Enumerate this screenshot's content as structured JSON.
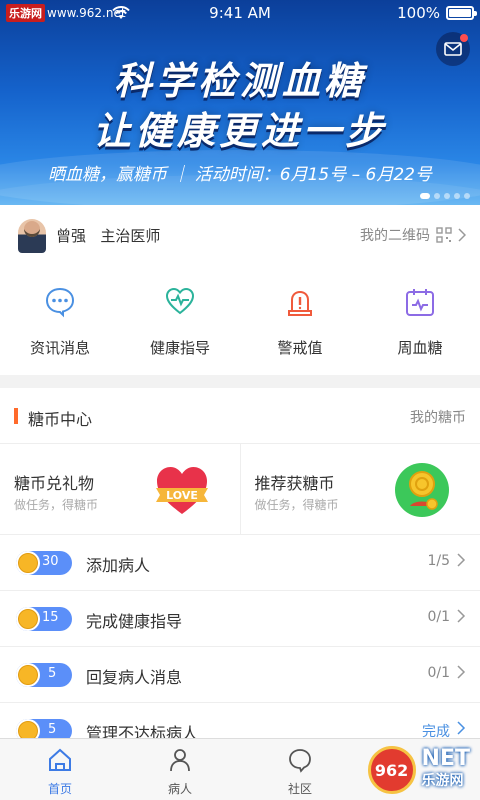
{
  "status": {
    "site": "乐游网",
    "url": "www.962.net",
    "time": "9:41 AM",
    "battery": "100%"
  },
  "banner": {
    "line1": "科学检测血糖",
    "line2": "让健康更进一步",
    "sub": "晒血糖，赢糖币 ｜ 活动时间：6月15号 – 6月22号"
  },
  "doctor": {
    "name": "曾强",
    "title": "主治医师",
    "qr_label": "我的二维码"
  },
  "tools": [
    {
      "label": "资讯消息",
      "icon": "chat-bubble-icon"
    },
    {
      "label": "健康指导",
      "icon": "heart-stethoscope-icon"
    },
    {
      "label": "警戒值",
      "icon": "alarm-light-icon"
    },
    {
      "label": "周血糖",
      "icon": "calendar-icon"
    }
  ],
  "coin_center": {
    "title": "糖币中心",
    "more": "我的糖币",
    "promos": [
      {
        "title": "糖币兑礼物",
        "sub": "做任务，得糖币",
        "badge": "LOVE"
      },
      {
        "title": "推荐获糖币",
        "sub": "做任务，得糖币"
      }
    ],
    "tasks": [
      {
        "coins": "30",
        "name": "添加病人",
        "progress": "1/5"
      },
      {
        "coins": "15",
        "name": "完成健康指导",
        "progress": "0/1"
      },
      {
        "coins": "5",
        "name": "回复病人消息",
        "progress": "0/1"
      },
      {
        "coins": "5",
        "name": "管理不达标病人",
        "progress": "完成"
      }
    ]
  },
  "tabs": [
    {
      "label": "首页"
    },
    {
      "label": "病人"
    },
    {
      "label": "社区"
    }
  ],
  "watermark": {
    "logo": "962",
    "text": "NET",
    "sub": "乐游网"
  },
  "colors": {
    "accent": "#3d7be5",
    "orange": "#ff6a2b",
    "coin": "#f7b626",
    "pill": "#5b8ff9"
  }
}
